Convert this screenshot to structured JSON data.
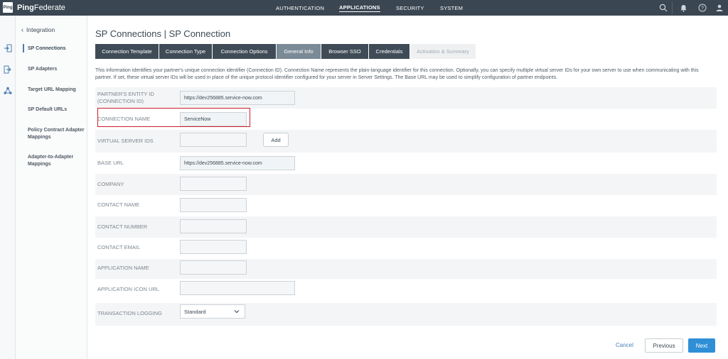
{
  "app": {
    "brand_badge": "Ping",
    "brand_bold": "Ping",
    "brand_light": "Federate"
  },
  "topnav": {
    "items": [
      "AUTHENTICATION",
      "APPLICATIONS",
      "SECURITY",
      "SYSTEM"
    ],
    "active": "APPLICATIONS"
  },
  "top_icons": [
    "search-icon",
    "bell-icon",
    "help-icon",
    "user-icon"
  ],
  "rail_icons": [
    "login-icon",
    "logout-icon",
    "network-icon"
  ],
  "sidebar": {
    "title": "Integration",
    "items": [
      {
        "label": "SP Connections",
        "active": true
      },
      {
        "label": "SP Adapters"
      },
      {
        "label": "Target URL Mapping"
      },
      {
        "label": "SP Default URLs"
      },
      {
        "label": "Policy Contract Adapter Mappings"
      },
      {
        "label": "Adapter-to-Adapter Mappings"
      }
    ]
  },
  "page": {
    "title": "SP Connections | SP Connection",
    "description": "This information identifies your partner's unique connection identifier (Connection ID). Connection Name represents the plain-language identifier for this connection. Optionally, you can specify multiple virtual server IDs for your own server to use when communicating with this partner. If set, these virtual server IDs will be used in place of the unique protocol identifier configured for your server in Server Settings. The Base URL may be used to simplify configuration of partner endpoints."
  },
  "tabs": [
    {
      "label": "Connection Template"
    },
    {
      "label": "Connection Type"
    },
    {
      "label": "Connection Options"
    },
    {
      "label": "General Info",
      "current": true
    },
    {
      "label": "Browser SSO"
    },
    {
      "label": "Credentials"
    },
    {
      "label": "Activation & Summary",
      "disabled": true
    }
  ],
  "form": {
    "entity_id": {
      "label": "PARTNER'S ENTITY ID (CONNECTION ID)",
      "value": "https://dev256885.service-now.com"
    },
    "connection_name": {
      "label": "CONNECTION NAME",
      "value": "ServiceNow"
    },
    "virtual_server_ids": {
      "label": "VIRTUAL SERVER IDS",
      "value": "",
      "add_label": "Add"
    },
    "base_url": {
      "label": "BASE URL",
      "value": "https://dev256885.service-now.com"
    },
    "company": {
      "label": "COMPANY",
      "value": ""
    },
    "contact_name": {
      "label": "CONTACT NAME",
      "value": ""
    },
    "contact_number": {
      "label": "CONTACT NUMBER",
      "value": ""
    },
    "contact_email": {
      "label": "CONTACT EMAIL",
      "value": ""
    },
    "application_name": {
      "label": "APPLICATION NAME",
      "value": ""
    },
    "application_icon_url": {
      "label": "APPLICATION ICON URL",
      "value": ""
    },
    "transaction_logging": {
      "label": "TRANSACTION LOGGING",
      "value": "Standard"
    }
  },
  "footer": {
    "cancel": "Cancel",
    "previous": "Previous",
    "next": "Next"
  },
  "colors": {
    "topbar": "#3a4651",
    "tab": "#3f4c57",
    "tab_current": "#7b8a97",
    "accent": "#2f8fd6",
    "highlight": "#c9202b"
  }
}
